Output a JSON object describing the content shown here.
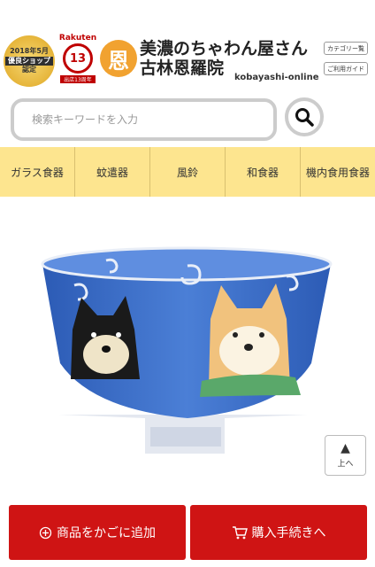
{
  "header": {
    "award_badge": {
      "line1": "2018年5月",
      "line2": "優良ショップ",
      "line3": "認定"
    },
    "rakuten_badge": {
      "brand": "Rakuten",
      "number": "13",
      "label": "出店13周年"
    },
    "logo_char": "恩",
    "shop_name_line1": "美濃のちゃわん屋さん",
    "shop_name_line2": "古林恩羅院",
    "shop_subtitle": "kobayashi-online",
    "category_button": "カテゴリー覧",
    "guide_button": "ご利用ガイド"
  },
  "search": {
    "placeholder": "検索キーワードを入力"
  },
  "nav": {
    "items": [
      "ガラス食器",
      "蚊遣器",
      "風鈴",
      "和食器",
      "機内食用食器"
    ]
  },
  "scroll_top": {
    "arrow": "▲",
    "label": "上へ"
  },
  "actions": {
    "add_to_cart": "商品をかごに追加",
    "checkout": "購入手続きへ"
  },
  "colors": {
    "nav_bg": "#fde58f",
    "action_red": "#cf1414",
    "bowl_blue": "#3f6fc6"
  }
}
